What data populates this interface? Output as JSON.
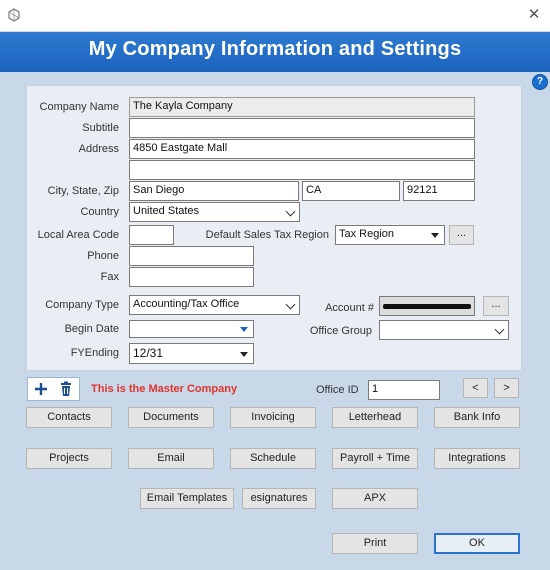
{
  "window": {
    "title": "My Company Information and Settings"
  },
  "form": {
    "company_name": {
      "label": "Company Name",
      "value": "The Kayla Company"
    },
    "subtitle": {
      "label": "Subtitle",
      "value": ""
    },
    "address": {
      "label": "Address",
      "line1": "4850 Eastgate Mall",
      "line2": ""
    },
    "city_state_zip": {
      "label": "City, State, Zip",
      "city": "San Diego",
      "state": "CA",
      "zip": "92121"
    },
    "country": {
      "label": "Country",
      "value": "United States"
    },
    "local_area_code": {
      "label": "Local Area Code",
      "value": ""
    },
    "default_sales_tax_region": {
      "label": "Default Sales Tax Region",
      "value": "Tax Region",
      "more": "..."
    },
    "phone": {
      "label": "Phone",
      "value": ""
    },
    "fax": {
      "label": "Fax",
      "value": ""
    },
    "company_type": {
      "label": "Company Type",
      "value": "Accounting/Tax Office"
    },
    "account": {
      "label": "Account #",
      "more": "..."
    },
    "begin_date": {
      "label": "Begin Date",
      "value": ""
    },
    "office_group": {
      "label": "Office Group",
      "value": ""
    },
    "fy_ending": {
      "label": "FYEnding",
      "value": "12/31"
    }
  },
  "toolbar": {
    "add_icon": "plus-icon",
    "delete_icon": "trash-icon",
    "master_message": "This is the Master Company",
    "office_id_label": "Office ID",
    "office_id_value": "1",
    "prev": "<",
    "next": ">"
  },
  "buttons": {
    "row1": [
      "Contacts",
      "Documents",
      "Invoicing",
      "Letterhead",
      "Bank Info"
    ],
    "row2": [
      "Projects",
      "Email",
      "Schedule",
      "Payroll + Time",
      "Integrations"
    ],
    "row3": [
      "Email Templates",
      "esignatures",
      "APX"
    ],
    "print": "Print",
    "ok": "OK"
  },
  "colors": {
    "banner": "#1b62bd",
    "master_text": "#e0352b",
    "background": "#c9d8e8"
  }
}
